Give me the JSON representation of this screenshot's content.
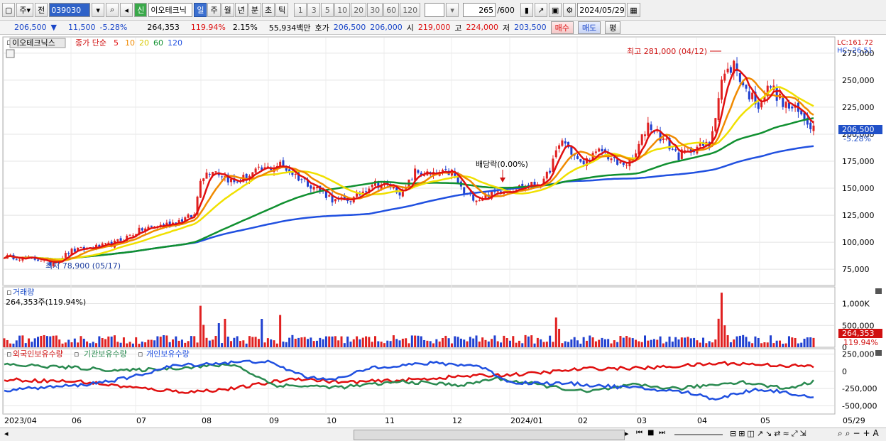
{
  "toolbar": {
    "market": "주",
    "kind": "전",
    "code": "039030",
    "tag": "신",
    "stock_name": "이오테크닉",
    "periods": [
      "일",
      "주",
      "월",
      "년",
      "분",
      "초",
      "틱"
    ],
    "selected_period": "일",
    "minutes": [
      "1",
      "3",
      "5",
      "10",
      "20",
      "30",
      "60",
      "120"
    ],
    "count": "265",
    "count_total": "/600",
    "date": "2024/05/29"
  },
  "quote": {
    "price": "206,500",
    "arrow": "▼",
    "change": "11,500",
    "change_pct": "-5.28%",
    "volume": "264,353",
    "volume_ratio": "119.94%",
    "turnover": "2.15%",
    "amount": "55,934백만",
    "ask_label": "호가",
    "ask": "206,500",
    "bid": "206,000",
    "open_label": "시",
    "open": "219,000",
    "high_label": "고",
    "high": "224,000",
    "low_label": "저",
    "low": "203,500",
    "buy_label": "매수",
    "sell_label": "매도",
    "eval_label": "평"
  },
  "price_panel": {
    "stock_label": "이오테크닉스",
    "ma_title": "종가 단순",
    "ma_periods": [
      "5",
      "10",
      "20",
      "60",
      "120"
    ],
    "lc": "LC:161.72",
    "hc": "HC:-26.51",
    "y_ticks": [
      "275,000",
      "250,000",
      "225,000",
      "200,000",
      "175,000",
      "150,000",
      "125,000",
      "100,000",
      "75,000"
    ],
    "price_tag": "206,500",
    "pct_tag": "-5.28%",
    "high_annot": "최고 281,000 (04/12)",
    "low_annot": "최저 78,900 (05/17)",
    "dividend_annot": "배당락(0.00%)"
  },
  "volume_panel": {
    "title": "거래량",
    "value": "264,353주(119.94%)",
    "y_ticks": [
      "1,000K",
      "500,000",
      "0"
    ],
    "tag": "264,353",
    "pct_tag": "119.94%"
  },
  "holding_panel": {
    "legend": [
      "외국인보유수량",
      "기관보유수량",
      "개인보유수량"
    ],
    "y_ticks": [
      "250,000",
      "0",
      "-250,000",
      "-500,000"
    ]
  },
  "x_labels": [
    "2023/04",
    "06",
    "07",
    "08",
    "09",
    "10",
    "11",
    "12",
    "2024/01",
    "02",
    "03",
    "04",
    "05",
    "05/29"
  ],
  "colors": {
    "ma5": "#e01010",
    "ma10": "#f08a00",
    "ma20": "#f0e000",
    "ma60": "#109030",
    "ma120": "#2050e0",
    "candle_up": "#e02020",
    "candle_down": "#2040d0",
    "foreign": "#e01010",
    "institution": "#2a8a50",
    "individual": "#2050e0"
  }
}
